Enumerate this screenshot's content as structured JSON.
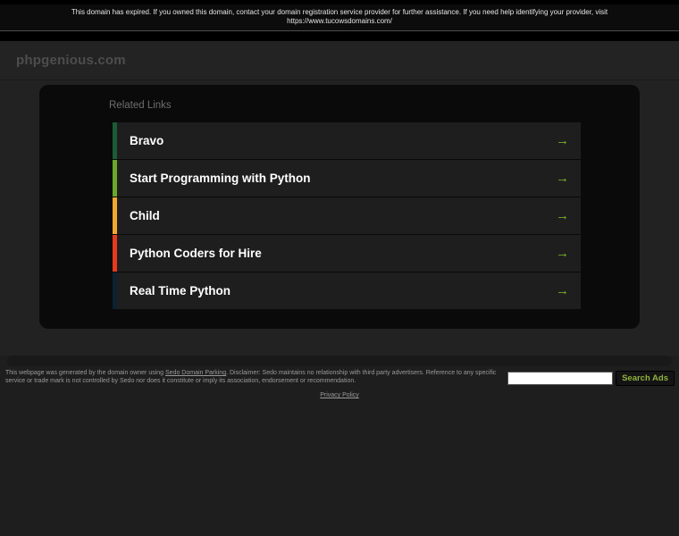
{
  "notice": {
    "text": "This domain has expired. If you owned this domain, contact your domain registration service provider for further assistance. If you need help identifying your provider, visit https://www.tucowsdomains.com/"
  },
  "header": {
    "domain": "phpgenious.com"
  },
  "related_links": {
    "title": "Related Links",
    "arrow_icon": "→",
    "arrow_color": "#7bbd2a",
    "items": [
      {
        "label": "Bravo",
        "bar_color": "#1b5c35"
      },
      {
        "label": "Start Programming with Python",
        "bar_color": "#6ba829"
      },
      {
        "label": "Child",
        "bar_color": "#f2a72f"
      },
      {
        "label": "Python Coders for Hire",
        "bar_color": "#e63a1e"
      },
      {
        "label": "Real Time Python",
        "bar_color": "#0d2231"
      }
    ]
  },
  "footer": {
    "disclaimer_prefix": "This webpage was generated by the domain owner using ",
    "disclaimer_link": "Sedo Domain Parking",
    "disclaimer_suffix": ". Disclaimer: Sedo maintains no relationship with third party advertisers. Reference to any specific service or trade mark is not controlled by Sedo nor does it constitute or imply its association, endorsement or recommendation.",
    "search_input_value": "",
    "search_button_label": "Search Ads",
    "privacy_link": "Privacy Policy"
  }
}
